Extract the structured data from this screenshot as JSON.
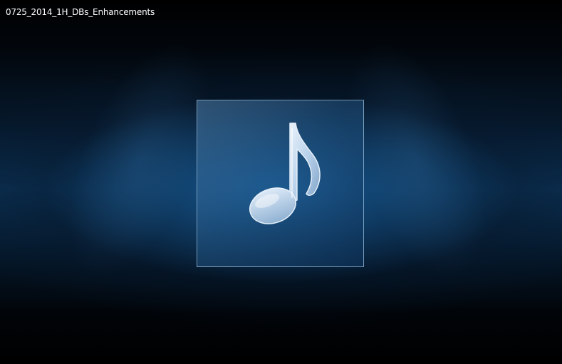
{
  "window": {
    "title": "0725_2014_1H_DBs_Enhancements"
  },
  "album_art": {
    "icon": "music-note-icon",
    "placeholder": true
  },
  "colors": {
    "background": "#0b3154",
    "frame_border": "#96b9d7",
    "note": "#c7dcf0"
  }
}
